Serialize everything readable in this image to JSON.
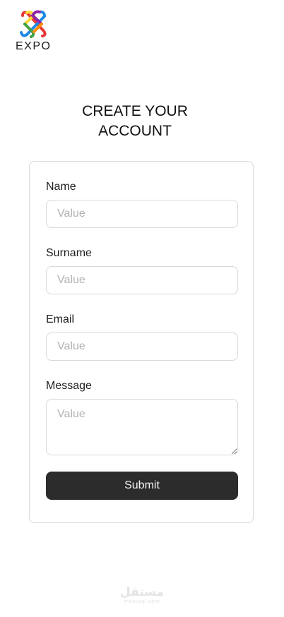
{
  "brand": {
    "logo_text": "EXPO",
    "logo_icon": "expo-knot-logo-icon",
    "colors": [
      "#e53935",
      "#fdd835",
      "#43a047",
      "#1e88e5",
      "#8e24aa"
    ]
  },
  "page": {
    "title_line1": "CREATE YOUR",
    "title_line2": "ACCOUNT"
  },
  "form": {
    "fields": [
      {
        "label": "Name",
        "placeholder": "Value",
        "value": ""
      },
      {
        "label": "Surname",
        "placeholder": "Value",
        "value": ""
      },
      {
        "label": "Email",
        "placeholder": "Value",
        "value": ""
      },
      {
        "label": "Message",
        "placeholder": "Value",
        "value": ""
      }
    ],
    "submit_label": "Submit",
    "submit_color": "#2c2c2c"
  },
  "watermark": {
    "main": "مستقل",
    "sub": "mostaql.com"
  }
}
